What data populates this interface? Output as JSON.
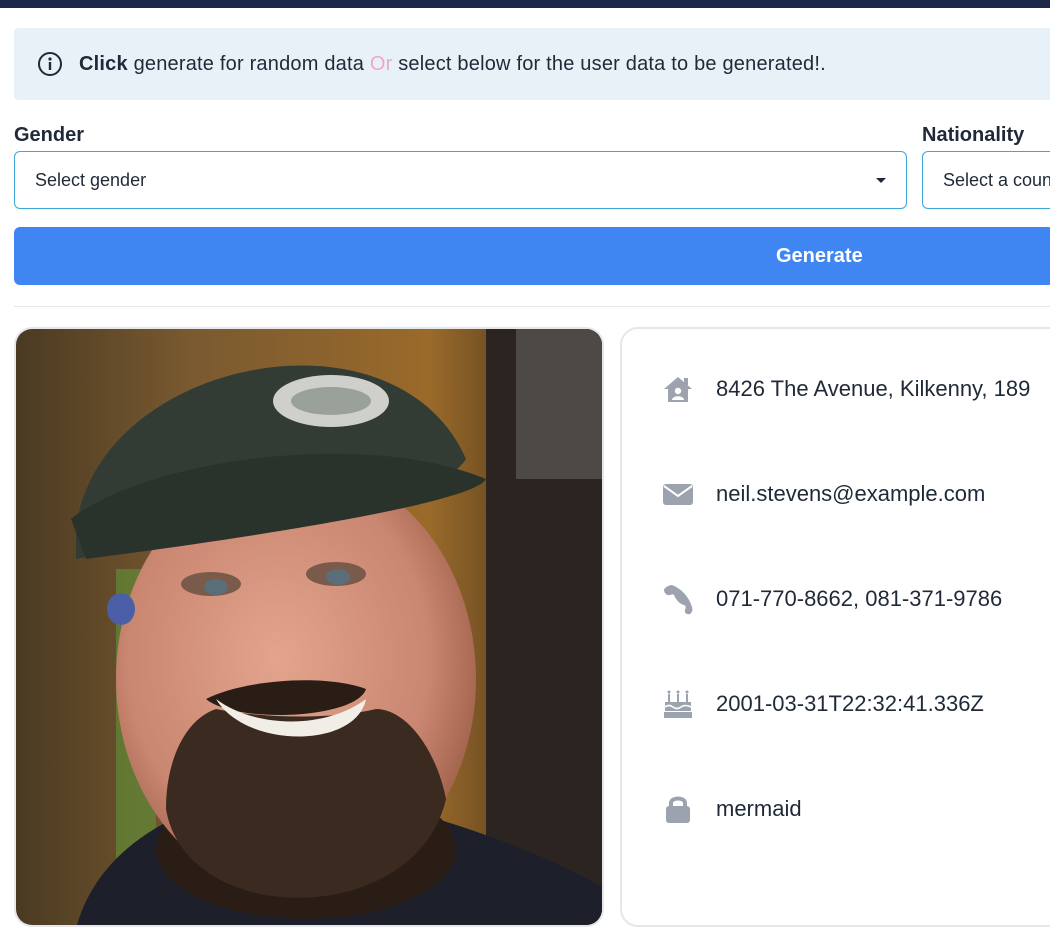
{
  "banner": {
    "click": "Click",
    "text1": " generate for random data ",
    "or": "Or",
    "text2": " select below for the user data to be generated!."
  },
  "filters": {
    "gender_label": "Gender",
    "gender_value": "Select gender",
    "nationality_label": "Nationality",
    "nationality_value": "Select a coun"
  },
  "generate_label": "Generate",
  "user": {
    "address": "8426 The Avenue, Kilkenny, 189",
    "email": "neil.stevens@example.com",
    "phone": "071-770-8662, 081-371-9786",
    "dob": "2001-03-31T22:32:41.336Z",
    "password": "mermaid"
  },
  "icons": {
    "info": "info-icon",
    "address": "house-user-icon",
    "email": "envelope-icon",
    "phone": "phone-icon",
    "dob": "birthday-cake-icon",
    "password": "lock-icon"
  },
  "colors": {
    "accent": "#3f86f2",
    "banner_bg": "#e8f1f8",
    "icon_gray": "#9ca3af",
    "topbar": "#1e2749"
  }
}
